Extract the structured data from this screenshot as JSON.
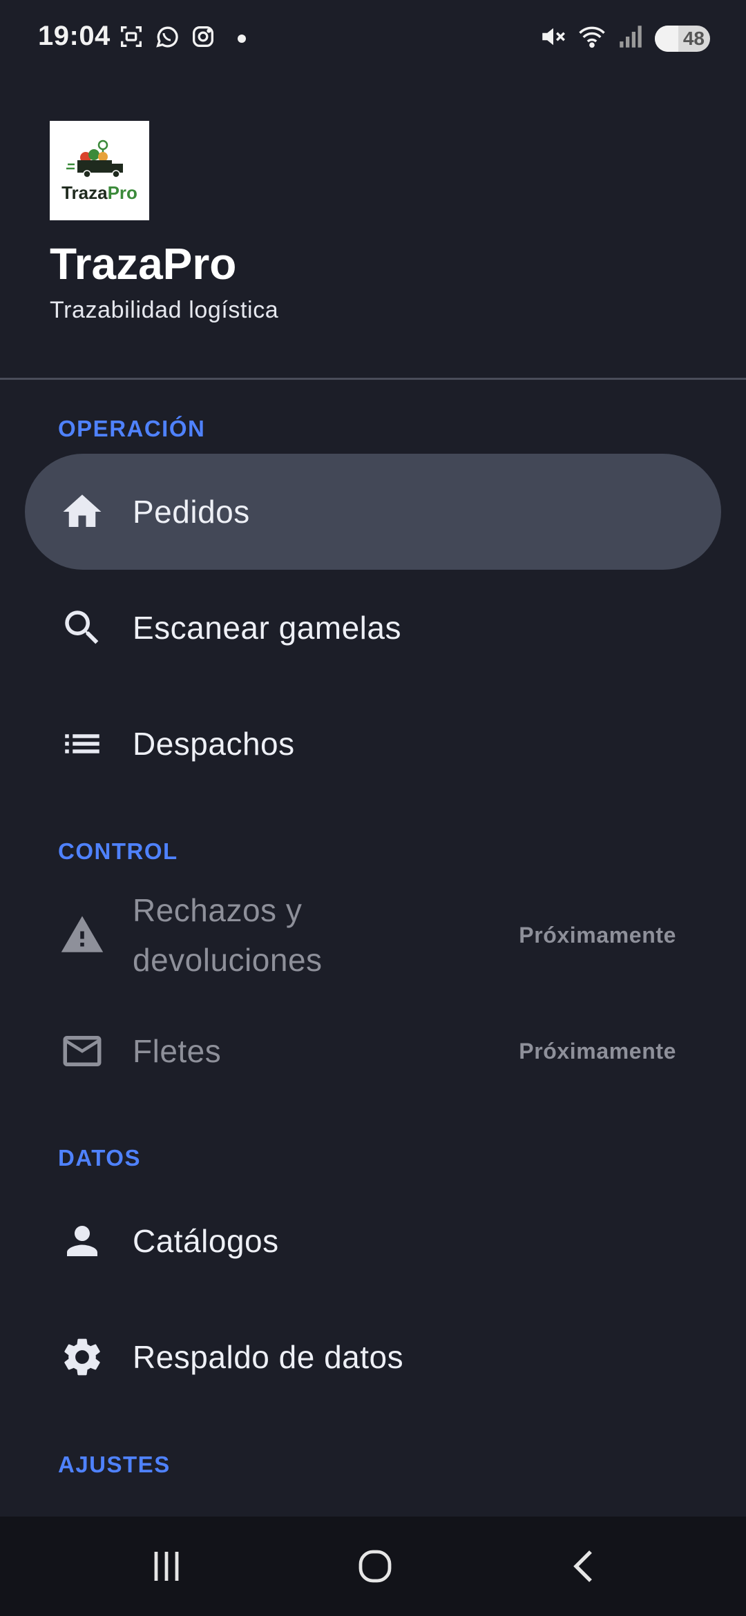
{
  "status_bar": {
    "time": "19:04",
    "battery_level": "48",
    "icons": [
      "screenshot-icon",
      "whatsapp-icon",
      "instagram-icon",
      "notification-dot",
      "mute-icon",
      "wifi-icon",
      "signal-icon",
      "battery-icon"
    ]
  },
  "header": {
    "logo_text_a": "Traza",
    "logo_text_b": "Pro",
    "title": "TrazaPro",
    "subtitle": "Trazabilidad logística"
  },
  "sections": {
    "operacion": "OPERACIÓN",
    "control": "CONTROL",
    "datos": "DATOS",
    "ajustes": "AJUSTES"
  },
  "items": {
    "pedidos": {
      "label": "Pedidos",
      "icon": "home-icon",
      "active": true
    },
    "escanear": {
      "label": "Escanear gamelas",
      "icon": "search-icon"
    },
    "despachos": {
      "label": "Despachos",
      "icon": "list-icon"
    },
    "rechazos": {
      "label_line1": "Rechazos y",
      "label_line2": "devoluciones",
      "icon": "warning-icon",
      "badge": "Próximamente",
      "disabled": true
    },
    "fletes": {
      "label": "Fletes",
      "icon": "mail-icon",
      "badge": "Próximamente",
      "disabled": true
    },
    "catalogos": {
      "label": "Catálogos",
      "icon": "person-icon"
    },
    "respaldo": {
      "label": "Respaldo de datos",
      "icon": "gear-icon"
    }
  },
  "colors": {
    "background": "#1c1e28",
    "accent": "#4f82ff",
    "active_item": "#434857",
    "disabled_text": "#8e909a"
  }
}
